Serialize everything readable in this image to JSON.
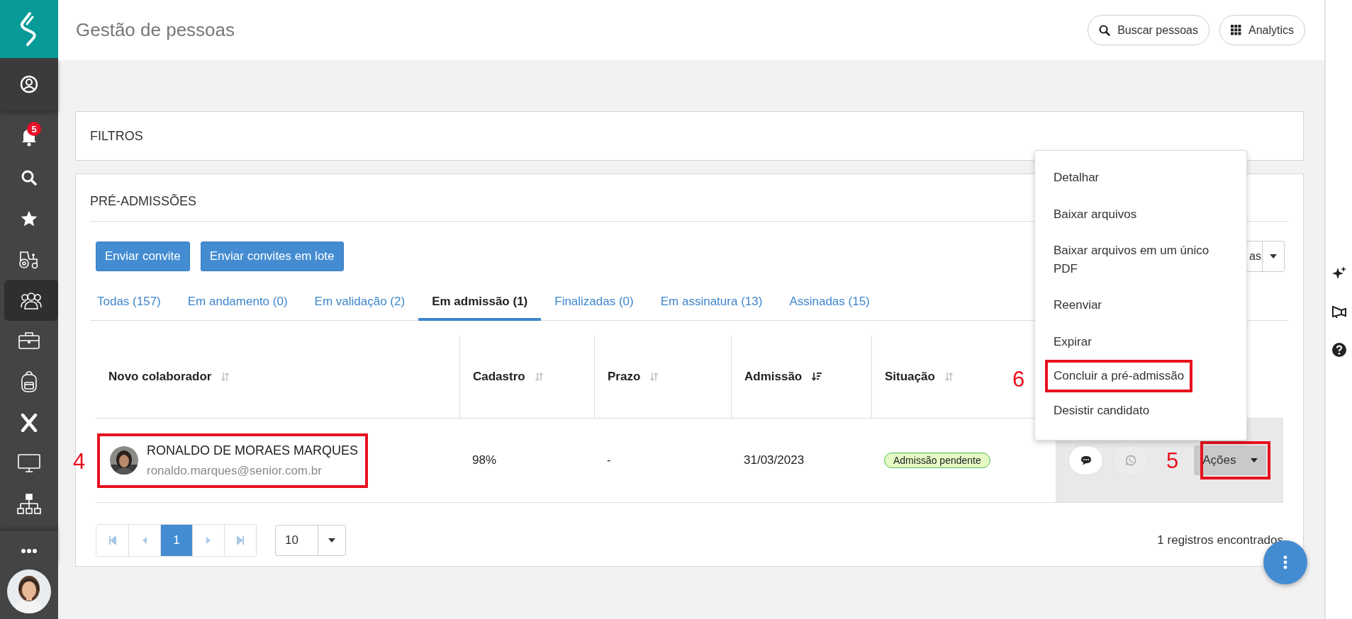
{
  "sidebar": {
    "items": [
      {
        "selected": false
      },
      {
        "selected": false,
        "badge": "5"
      },
      {
        "selected": false
      },
      {
        "selected": false
      },
      {
        "selected": false
      },
      {
        "selected": true
      },
      {
        "selected": false
      },
      {
        "selected": false
      },
      {
        "selected": false
      },
      {
        "selected": false
      },
      {
        "selected": false
      },
      {
        "selected": false
      }
    ]
  },
  "header": {
    "title": "Gestão de pessoas",
    "buttons": [
      {
        "label": "Buscar pessoas"
      },
      {
        "label": "Analytics"
      }
    ]
  },
  "filters": {
    "title": "FILTROS"
  },
  "pre_admissions": {
    "title": "PRÉ-ADMISSÕES",
    "buttons": [
      {
        "label": "Enviar convite"
      },
      {
        "label": "Enviar convites em lote"
      }
    ],
    "column_button": {
      "label": "as"
    },
    "tabs": [
      {
        "label": "Todas (157)",
        "selected": false
      },
      {
        "label": "Em andamento (0)",
        "selected": false
      },
      {
        "label": "Em validação (2)",
        "selected": false
      },
      {
        "label": "Em admissão (1)",
        "selected": true
      },
      {
        "label": "Finalizadas (0)",
        "selected": false
      },
      {
        "label": "Em assinatura (13)",
        "selected": false
      },
      {
        "label": "Assinadas (15)",
        "selected": false
      }
    ],
    "columns": [
      {
        "label": "Novo colaborador",
        "sorted": false
      },
      {
        "label": "Cadastro",
        "sorted": false
      },
      {
        "label": "Prazo",
        "sorted": false
      },
      {
        "label": "Admissão",
        "sorted": true
      },
      {
        "label": "Situação",
        "sorted": false
      }
    ],
    "rows": [
      {
        "name": "RONALDO DE MORAES MARQUES",
        "email": "ronaldo.marques@senior.com.br",
        "annotation": "4",
        "cadastro": "98%",
        "prazo": "-",
        "admissao": "31/03/2023",
        "status": "Admissão pendente",
        "chat_disabled": false,
        "whatsapp_disabled": true,
        "actions": {
          "label": "Ações",
          "annotation": "5"
        }
      }
    ],
    "pagination": {
      "pages": [
        {
          "label": "1",
          "selected": true
        }
      ],
      "page_size": "10"
    },
    "record_count": "1 registros encontrados"
  },
  "menu": {
    "items": [
      {
        "label": "Detalhar"
      },
      {
        "label": "Baixar arquivos"
      },
      {
        "label": "Baixar arquivos em um único PDF"
      },
      {
        "label": "Reenviar"
      },
      {
        "label": "Expirar"
      },
      {
        "label": "Concluir a pré-admissão",
        "annotation": "6"
      },
      {
        "label": "Desistir candidato"
      }
    ]
  }
}
